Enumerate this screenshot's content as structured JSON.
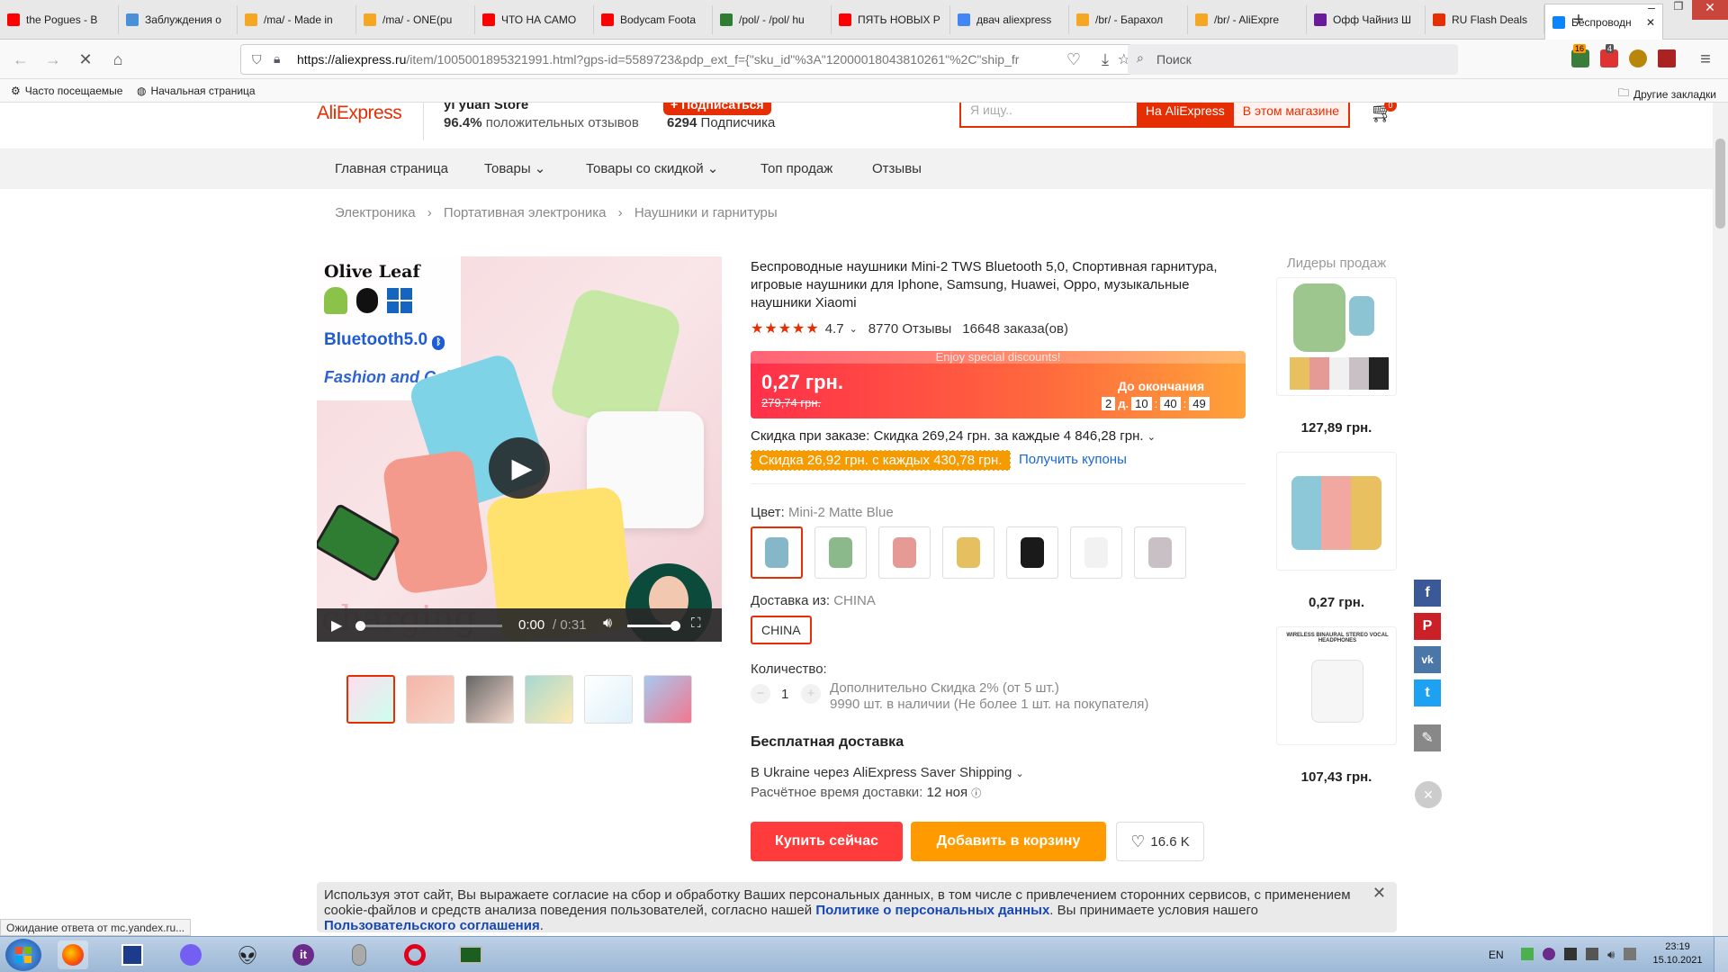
{
  "browser": {
    "tabs": [
      {
        "label": "the Pogues - B",
        "icon": "youtube-icon",
        "color": "#ff0000"
      },
      {
        "label": "Заблуждения о",
        "icon": "star-icon",
        "color": "#4a90d9"
      },
      {
        "label": "/ma/ - Made in",
        "icon": "bolt-icon",
        "color": "#f5a623"
      },
      {
        "label": "/ma/ - ONE(pu",
        "icon": "bolt-icon",
        "color": "#f5a623"
      },
      {
        "label": "ЧТО НА САМО",
        "icon": "youtube-icon",
        "color": "#ff0000"
      },
      {
        "label": "Bodycam Foota",
        "icon": "youtube-icon",
        "color": "#ff0000"
      },
      {
        "label": "/pol/ - /pol/ hu",
        "icon": "clover-icon",
        "color": "#2e7d32"
      },
      {
        "label": "ПЯТЬ НОВЫХ Р",
        "icon": "youtube-icon",
        "color": "#ff0000"
      },
      {
        "label": "двач aliexpress",
        "icon": "google-icon",
        "color": "#4285f4"
      },
      {
        "label": "/br/ - Барахол",
        "icon": "bolt-icon",
        "color": "#f5a623"
      },
      {
        "label": "/br/ - AliExpre",
        "icon": "bolt-icon",
        "color": "#f5a623"
      },
      {
        "label": "Офф Чайниз Ш",
        "icon": "store-icon",
        "color": "#6a1b9a"
      },
      {
        "label": "RU Flash Deals",
        "icon": "ali-icon",
        "color": "#e62e04"
      },
      {
        "label": "Беспроводн",
        "icon": "loading-icon",
        "color": "#0a84ff",
        "active": true
      }
    ],
    "url_domain": "https://aliexpress.ru",
    "url_rest": "/item/1005001895321991.html?gps-id=5589723&pdp_ext_f={\"sku_id\"%3A\"12000018043810261\"%2C\"ship_fr",
    "search_placeholder": "Поиск",
    "bookmarks": [
      "Часто посещаемые",
      "Начальная страница"
    ],
    "other_bookmarks": "Другие закладки",
    "status_text": "Ожидание ответа от mc.yandex.ru...",
    "ext_badges": [
      "16",
      "4"
    ]
  },
  "header": {
    "logo": "AliExpress",
    "store_name": "yi yuan Store",
    "rating_pct": "96.4%",
    "rating_label": "положительных отзывов",
    "subscribe_button": "+ Подписаться",
    "subscribers_count": "6294",
    "subscribers_label": "Подписчика",
    "search_placeholder": "Я ищу..",
    "search_ali_button": "На AliExpress",
    "search_store_button": "В этом магазине",
    "cart_count": "0"
  },
  "menu": [
    "Главная страница",
    "Товары",
    "Товары со скидкой",
    "Топ продаж",
    "Отзывы"
  ],
  "breadcrumb": [
    "Электроника",
    "Портативная электроника",
    "Наушники и гарнитуры"
  ],
  "gallery": {
    "brand": "Olive Leaf",
    "bluetooth": "Bluetooth5.0",
    "tagline": "Fashion and Colorful",
    "charging": "charging",
    "video_time": "0:00",
    "video_duration": "0:31",
    "video_progress": 0.0,
    "volume_level": 0.95
  },
  "product": {
    "title": "Беспроводные наушники Mini-2 TWS Bluetooth 5,0, Спортивная гарнитура, игровые наушники для Iphone, Samsung, Huawei, Oppo, музыкальные наушники Xiaomi",
    "rating": "4.7",
    "reviews": "8770 Отзывы",
    "orders": "16648 заказа(ов)",
    "promo_banner": "Enjoy special discounts!",
    "price": "0,27 грн.",
    "old_price": "279,74 грн.",
    "countdown_label": "До окончания",
    "countdown": [
      "2",
      "д.",
      "10",
      "40",
      "49"
    ],
    "order_discount": "Скидка при заказе: Скидка 269,24 грн. за каждые 4 846,28 грн.",
    "coupon_badge": "Скидка 26,92 грн. с каждых 430,78 грн.",
    "coupon_link": "Получить купоны",
    "color_label": "Цвет:",
    "color_value": "Mini-2 Matte Blue",
    "colors": [
      "#86b7c8",
      "#8cb98c",
      "#e69a96",
      "#e6c060",
      "#1a1a1a",
      "#f2f2f2",
      "#c8c0c4"
    ],
    "ship_from_label": "Доставка из:",
    "ship_from_value": "CHINA",
    "ship_from_option": "CHINA",
    "qty_label": "Количество:",
    "qty_value": "1",
    "qty_discount": "Дополнительно Скидка 2% (от 5 шт.)",
    "stock": "9990 шт. в наличии (Не более 1 шт. на покупателя)",
    "free_shipping": "Бесплатная доставка",
    "shipping_method": "В Ukraine через AliExpress Saver Shipping",
    "eta_label": "Расчётное время доставки:",
    "eta_value": "12 ноя",
    "buy_button": "Купить сейчас",
    "cart_button": "Добавить в корзину",
    "wishlist_count": "16.6 K"
  },
  "bestsellers": {
    "title": "Лидеры продаж",
    "items": [
      {
        "price": "127,89 грн."
      },
      {
        "price": "0,27 грн."
      },
      {
        "price": "107,43 грн.",
        "caption": "WIRELESS BINAURAL STEREO VOCAL HEADPHONES"
      }
    ]
  },
  "social": [
    "facebook-icon",
    "pinterest-icon",
    "vk-icon",
    "twitter-icon"
  ],
  "cookie": {
    "text_part1": "Используя этот сайт, Вы выражаете согласие на сбор и обработку Ваших персональных данных, в том числе с привлечением сторонних сервисов, с применением cookie-файлов и средств анализа поведения пользователей, согласно нашей ",
    "link1": "Политике о персональных данных",
    "text_part2": ". Вы принимаете условия нашего ",
    "link2": "Пользовательского соглашения",
    "text_part3": "."
  },
  "taskbar": {
    "lang": "EN",
    "time": "23:19",
    "date": "15.10.2021"
  }
}
